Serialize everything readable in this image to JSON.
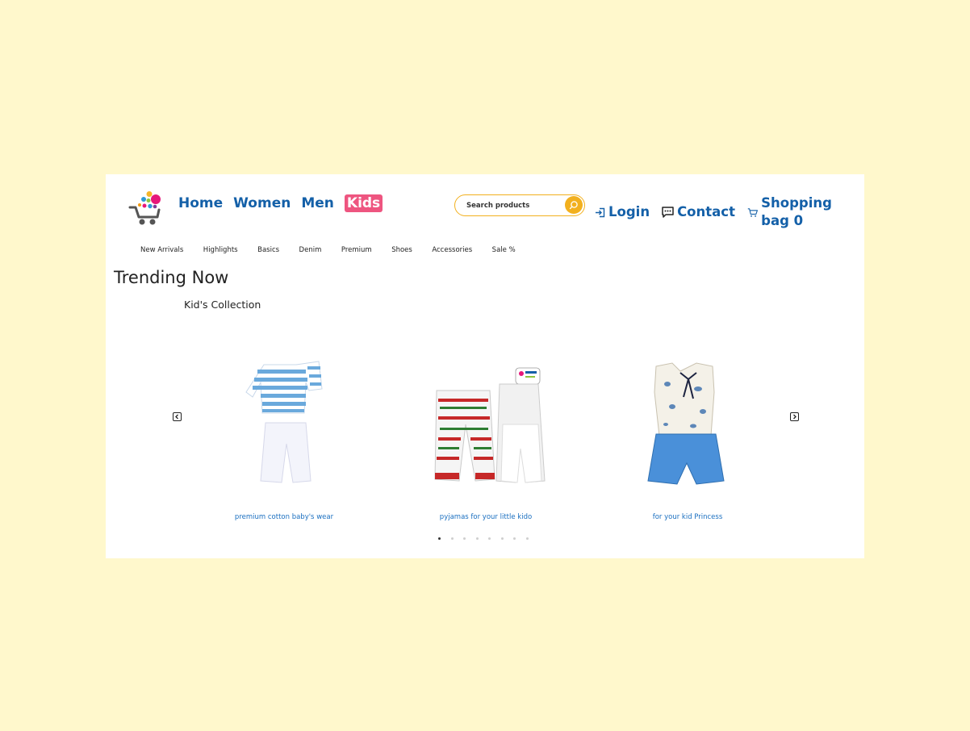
{
  "header": {
    "nav": [
      {
        "label": "Home"
      },
      {
        "label": "Women"
      },
      {
        "label": "Men"
      },
      {
        "label": "Kids"
      }
    ],
    "search": {
      "placeholder": "Search products"
    },
    "links": {
      "login": "Login",
      "contact": "Contact",
      "bag": "Shopping bag 0"
    },
    "icons": [
      "login-icon",
      "chat-icon",
      "cart-icon",
      "search-icon"
    ]
  },
  "subnav": [
    "New Arrivals",
    "Highlights",
    "Basics",
    "Denim",
    "Premium",
    "Shoes",
    "Accessories",
    "Sale %"
  ],
  "main": {
    "title": "Trending Now",
    "subtitle": "Kid's Collection"
  },
  "carousel": {
    "products": [
      {
        "caption": "premium cotton baby's wear"
      },
      {
        "caption": "pyjamas for your little kido"
      },
      {
        "caption": "for your kid Princess"
      }
    ],
    "dot_count": 8,
    "active_dot": 1
  },
  "colors": {
    "page_background": "#fff8cc",
    "nav_blue": "#1460a8",
    "active_nav": "#ee5580",
    "search_accent": "#f2b01e",
    "caption_blue": "#1a6fc0"
  }
}
